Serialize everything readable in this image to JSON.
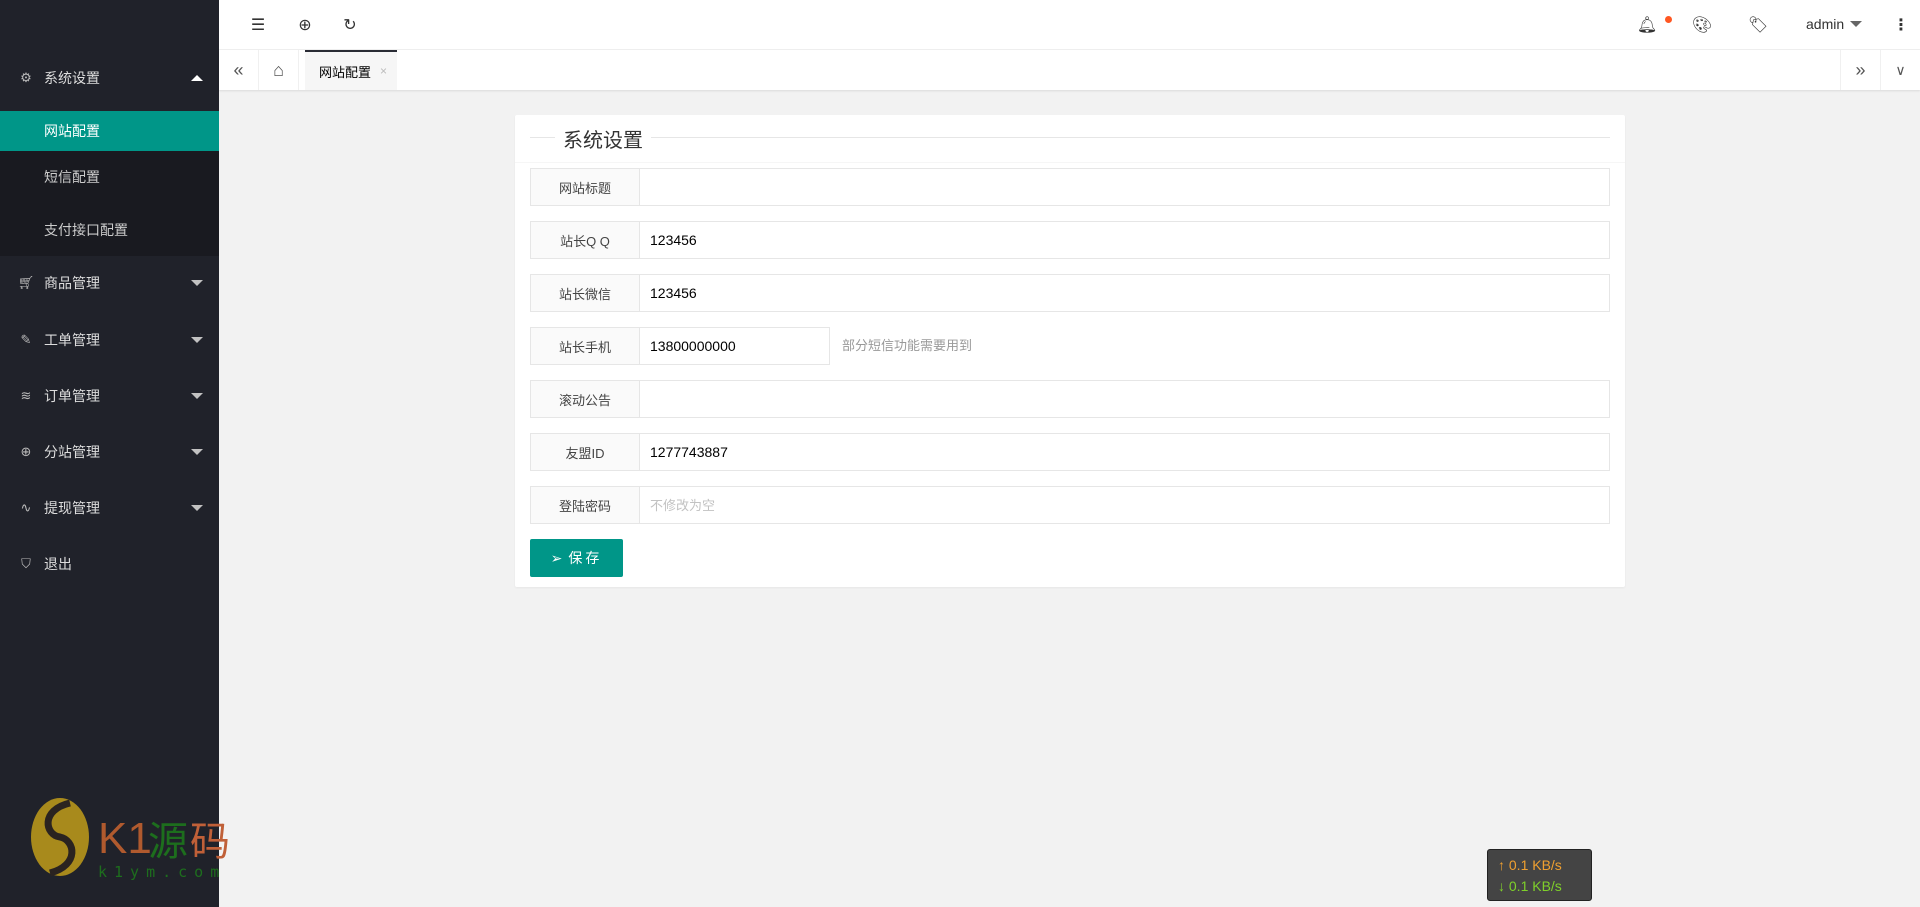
{
  "sidebar": {
    "open_menu": {
      "label": "系统设置",
      "icon": "gear-icon",
      "items": [
        {
          "label": "网站配置",
          "active": true
        },
        {
          "label": "短信配置"
        },
        {
          "label": "支付接口配置"
        }
      ]
    },
    "menus": [
      {
        "label": "商品管理",
        "icon": "cart-icon"
      },
      {
        "label": "工单管理",
        "icon": "ticket-icon"
      },
      {
        "label": "订单管理",
        "icon": "layers-icon"
      },
      {
        "label": "分站管理",
        "icon": "globe-icon"
      },
      {
        "label": "提现管理",
        "icon": "pulse-icon"
      }
    ],
    "logout": {
      "label": "退出",
      "icon": "shield-check-icon"
    },
    "watermark": {
      "text": "K1源码",
      "sub": "k1ym.com"
    }
  },
  "header": {
    "user": "admin",
    "notification_dot_color": "#ff5722"
  },
  "tabs": {
    "items": [
      {
        "label": "网站配置",
        "close": "×"
      }
    ]
  },
  "form": {
    "title": "系统设置",
    "fields": [
      {
        "label": "网站标题",
        "value": "",
        "placeholder": ""
      },
      {
        "label": "站长Q Q",
        "value": "123456",
        "placeholder": ""
      },
      {
        "label": "站长微信",
        "value": "123456",
        "placeholder": ""
      },
      {
        "label": "站长手机",
        "value": "13800000000",
        "placeholder": "",
        "aux": "部分短信功能需要用到"
      },
      {
        "label": "滚动公告",
        "value": "",
        "placeholder": ""
      },
      {
        "label": "友盟ID",
        "value": "1277743887",
        "placeholder": ""
      },
      {
        "label": "登陆密码",
        "value": "",
        "placeholder": "不修改为空"
      }
    ],
    "save_label": "保存"
  },
  "netspeed": {
    "up": "0.1 KB/s",
    "down": "0.1 KB/s",
    "up_color": "#f0a030",
    "down_color": "#7fd02a"
  },
  "colors": {
    "accent": "#009688",
    "sidebar": "#20222a"
  }
}
